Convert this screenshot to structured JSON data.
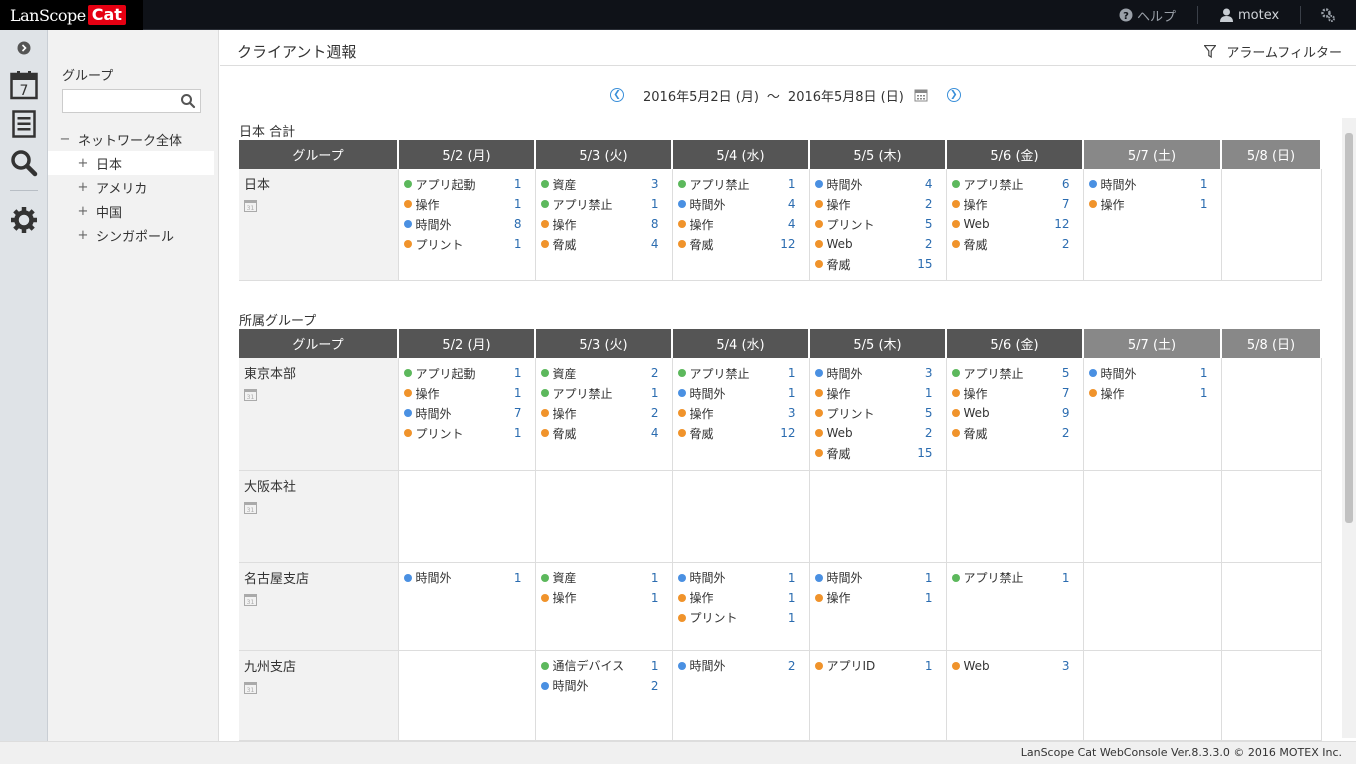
{
  "app": {
    "logo_text": "LanScope",
    "logo_badge": "Cat",
    "help_label": "ヘルプ",
    "user_name": "motex"
  },
  "sidebar_icons": [
    "chevron-right-icon",
    "calendar-icon",
    "report-icon",
    "search-icon",
    "gear-icon"
  ],
  "calendar_icon_day": "7",
  "group_panel": {
    "title": "グループ",
    "search_placeholder": "",
    "tree": [
      {
        "sign": "−",
        "label": "ネットワーク全体",
        "level": 0
      },
      {
        "sign": "+",
        "label": "日本",
        "level": 1,
        "selected": true
      },
      {
        "sign": "+",
        "label": "アメリカ",
        "level": 1
      },
      {
        "sign": "+",
        "label": "中国",
        "level": 1
      },
      {
        "sign": "+",
        "label": "シンガポール",
        "level": 1
      }
    ]
  },
  "page": {
    "title": "クライアント週報",
    "alarm_filter": "アラームフィルター",
    "date_start": "2016年5月2日 (月)",
    "date_sep": "〜",
    "date_end": "2016年5月8日 (日)"
  },
  "columns": {
    "group": "グループ",
    "days": [
      "5/2 (月)",
      "5/3 (火)",
      "5/4 (水)",
      "5/5 (木)",
      "5/6 (金)",
      "5/7 (土)",
      "5/8 (日)"
    ],
    "weekend": [
      false,
      false,
      false,
      false,
      false,
      true,
      true
    ]
  },
  "summary": {
    "section_title": "日本 合計",
    "rows": [
      {
        "name": "日本",
        "days": [
          [
            {
              "c": "green",
              "l": "アプリ起動",
              "n": "1"
            },
            {
              "c": "orange",
              "l": "操作",
              "n": "1"
            },
            {
              "c": "blue",
              "l": "時間外",
              "n": "8"
            },
            {
              "c": "orange",
              "l": "プリント",
              "n": "1"
            }
          ],
          [
            {
              "c": "green",
              "l": "資産",
              "n": "3"
            },
            {
              "c": "green",
              "l": "アプリ禁止",
              "n": "1"
            },
            {
              "c": "orange",
              "l": "操作",
              "n": "8"
            },
            {
              "c": "orange",
              "l": "脅威",
              "n": "4"
            }
          ],
          [
            {
              "c": "green",
              "l": "アプリ禁止",
              "n": "1"
            },
            {
              "c": "blue",
              "l": "時間外",
              "n": "4"
            },
            {
              "c": "orange",
              "l": "操作",
              "n": "4"
            },
            {
              "c": "orange",
              "l": "脅威",
              "n": "12"
            }
          ],
          [
            {
              "c": "blue",
              "l": "時間外",
              "n": "4"
            },
            {
              "c": "orange",
              "l": "操作",
              "n": "2"
            },
            {
              "c": "orange",
              "l": "プリント",
              "n": "5"
            },
            {
              "c": "orange",
              "l": "Web",
              "n": "2"
            },
            {
              "c": "orange",
              "l": "脅威",
              "n": "15"
            }
          ],
          [
            {
              "c": "green",
              "l": "アプリ禁止",
              "n": "6"
            },
            {
              "c": "orange",
              "l": "操作",
              "n": "7"
            },
            {
              "c": "orange",
              "l": "Web",
              "n": "12"
            },
            {
              "c": "orange",
              "l": "脅威",
              "n": "2"
            }
          ],
          [
            {
              "c": "blue",
              "l": "時間外",
              "n": "1"
            },
            {
              "c": "orange",
              "l": "操作",
              "n": "1"
            }
          ],
          []
        ]
      }
    ]
  },
  "groups": {
    "section_title": "所属グループ",
    "rows": [
      {
        "name": "東京本部",
        "days": [
          [
            {
              "c": "green",
              "l": "アプリ起動",
              "n": "1"
            },
            {
              "c": "orange",
              "l": "操作",
              "n": "1"
            },
            {
              "c": "blue",
              "l": "時間外",
              "n": "7"
            },
            {
              "c": "orange",
              "l": "プリント",
              "n": "1"
            }
          ],
          [
            {
              "c": "green",
              "l": "資産",
              "n": "2"
            },
            {
              "c": "green",
              "l": "アプリ禁止",
              "n": "1"
            },
            {
              "c": "orange",
              "l": "操作",
              "n": "2"
            },
            {
              "c": "orange",
              "l": "脅威",
              "n": "4"
            }
          ],
          [
            {
              "c": "green",
              "l": "アプリ禁止",
              "n": "1"
            },
            {
              "c": "blue",
              "l": "時間外",
              "n": "1"
            },
            {
              "c": "orange",
              "l": "操作",
              "n": "3"
            },
            {
              "c": "orange",
              "l": "脅威",
              "n": "12"
            }
          ],
          [
            {
              "c": "blue",
              "l": "時間外",
              "n": "3"
            },
            {
              "c": "orange",
              "l": "操作",
              "n": "1"
            },
            {
              "c": "orange",
              "l": "プリント",
              "n": "5"
            },
            {
              "c": "orange",
              "l": "Web",
              "n": "2"
            },
            {
              "c": "orange",
              "l": "脅威",
              "n": "15"
            }
          ],
          [
            {
              "c": "green",
              "l": "アプリ禁止",
              "n": "5"
            },
            {
              "c": "orange",
              "l": "操作",
              "n": "7"
            },
            {
              "c": "orange",
              "l": "Web",
              "n": "9"
            },
            {
              "c": "orange",
              "l": "脅威",
              "n": "2"
            }
          ],
          [
            {
              "c": "blue",
              "l": "時間外",
              "n": "1"
            },
            {
              "c": "orange",
              "l": "操作",
              "n": "1"
            }
          ],
          []
        ]
      },
      {
        "name": "大阪本社",
        "days": [
          [],
          [],
          [],
          [],
          [],
          [],
          []
        ]
      },
      {
        "name": "名古屋支店",
        "days": [
          [
            {
              "c": "blue",
              "l": "時間外",
              "n": "1"
            }
          ],
          [
            {
              "c": "green",
              "l": "資産",
              "n": "1"
            },
            {
              "c": "orange",
              "l": "操作",
              "n": "1"
            }
          ],
          [
            {
              "c": "blue",
              "l": "時間外",
              "n": "1"
            },
            {
              "c": "orange",
              "l": "操作",
              "n": "1"
            },
            {
              "c": "orange",
              "l": "プリント",
              "n": "1"
            }
          ],
          [
            {
              "c": "blue",
              "l": "時間外",
              "n": "1"
            },
            {
              "c": "orange",
              "l": "操作",
              "n": "1"
            }
          ],
          [
            {
              "c": "green",
              "l": "アプリ禁止",
              "n": "1"
            }
          ],
          [],
          []
        ]
      },
      {
        "name": "九州支店",
        "days": [
          [],
          [
            {
              "c": "green",
              "l": "通信デバイス",
              "n": "1"
            },
            {
              "c": "blue",
              "l": "時間外",
              "n": "2"
            }
          ],
          [
            {
              "c": "blue",
              "l": "時間外",
              "n": "2"
            }
          ],
          [
            {
              "c": "orange",
              "l": "アプリID",
              "n": "1"
            }
          ],
          [
            {
              "c": "orange",
              "l": "Web",
              "n": "3"
            }
          ],
          [],
          []
        ]
      }
    ]
  },
  "footer": "LanScope Cat WebConsole Ver.8.3.3.0 © 2016 MOTEX Inc."
}
